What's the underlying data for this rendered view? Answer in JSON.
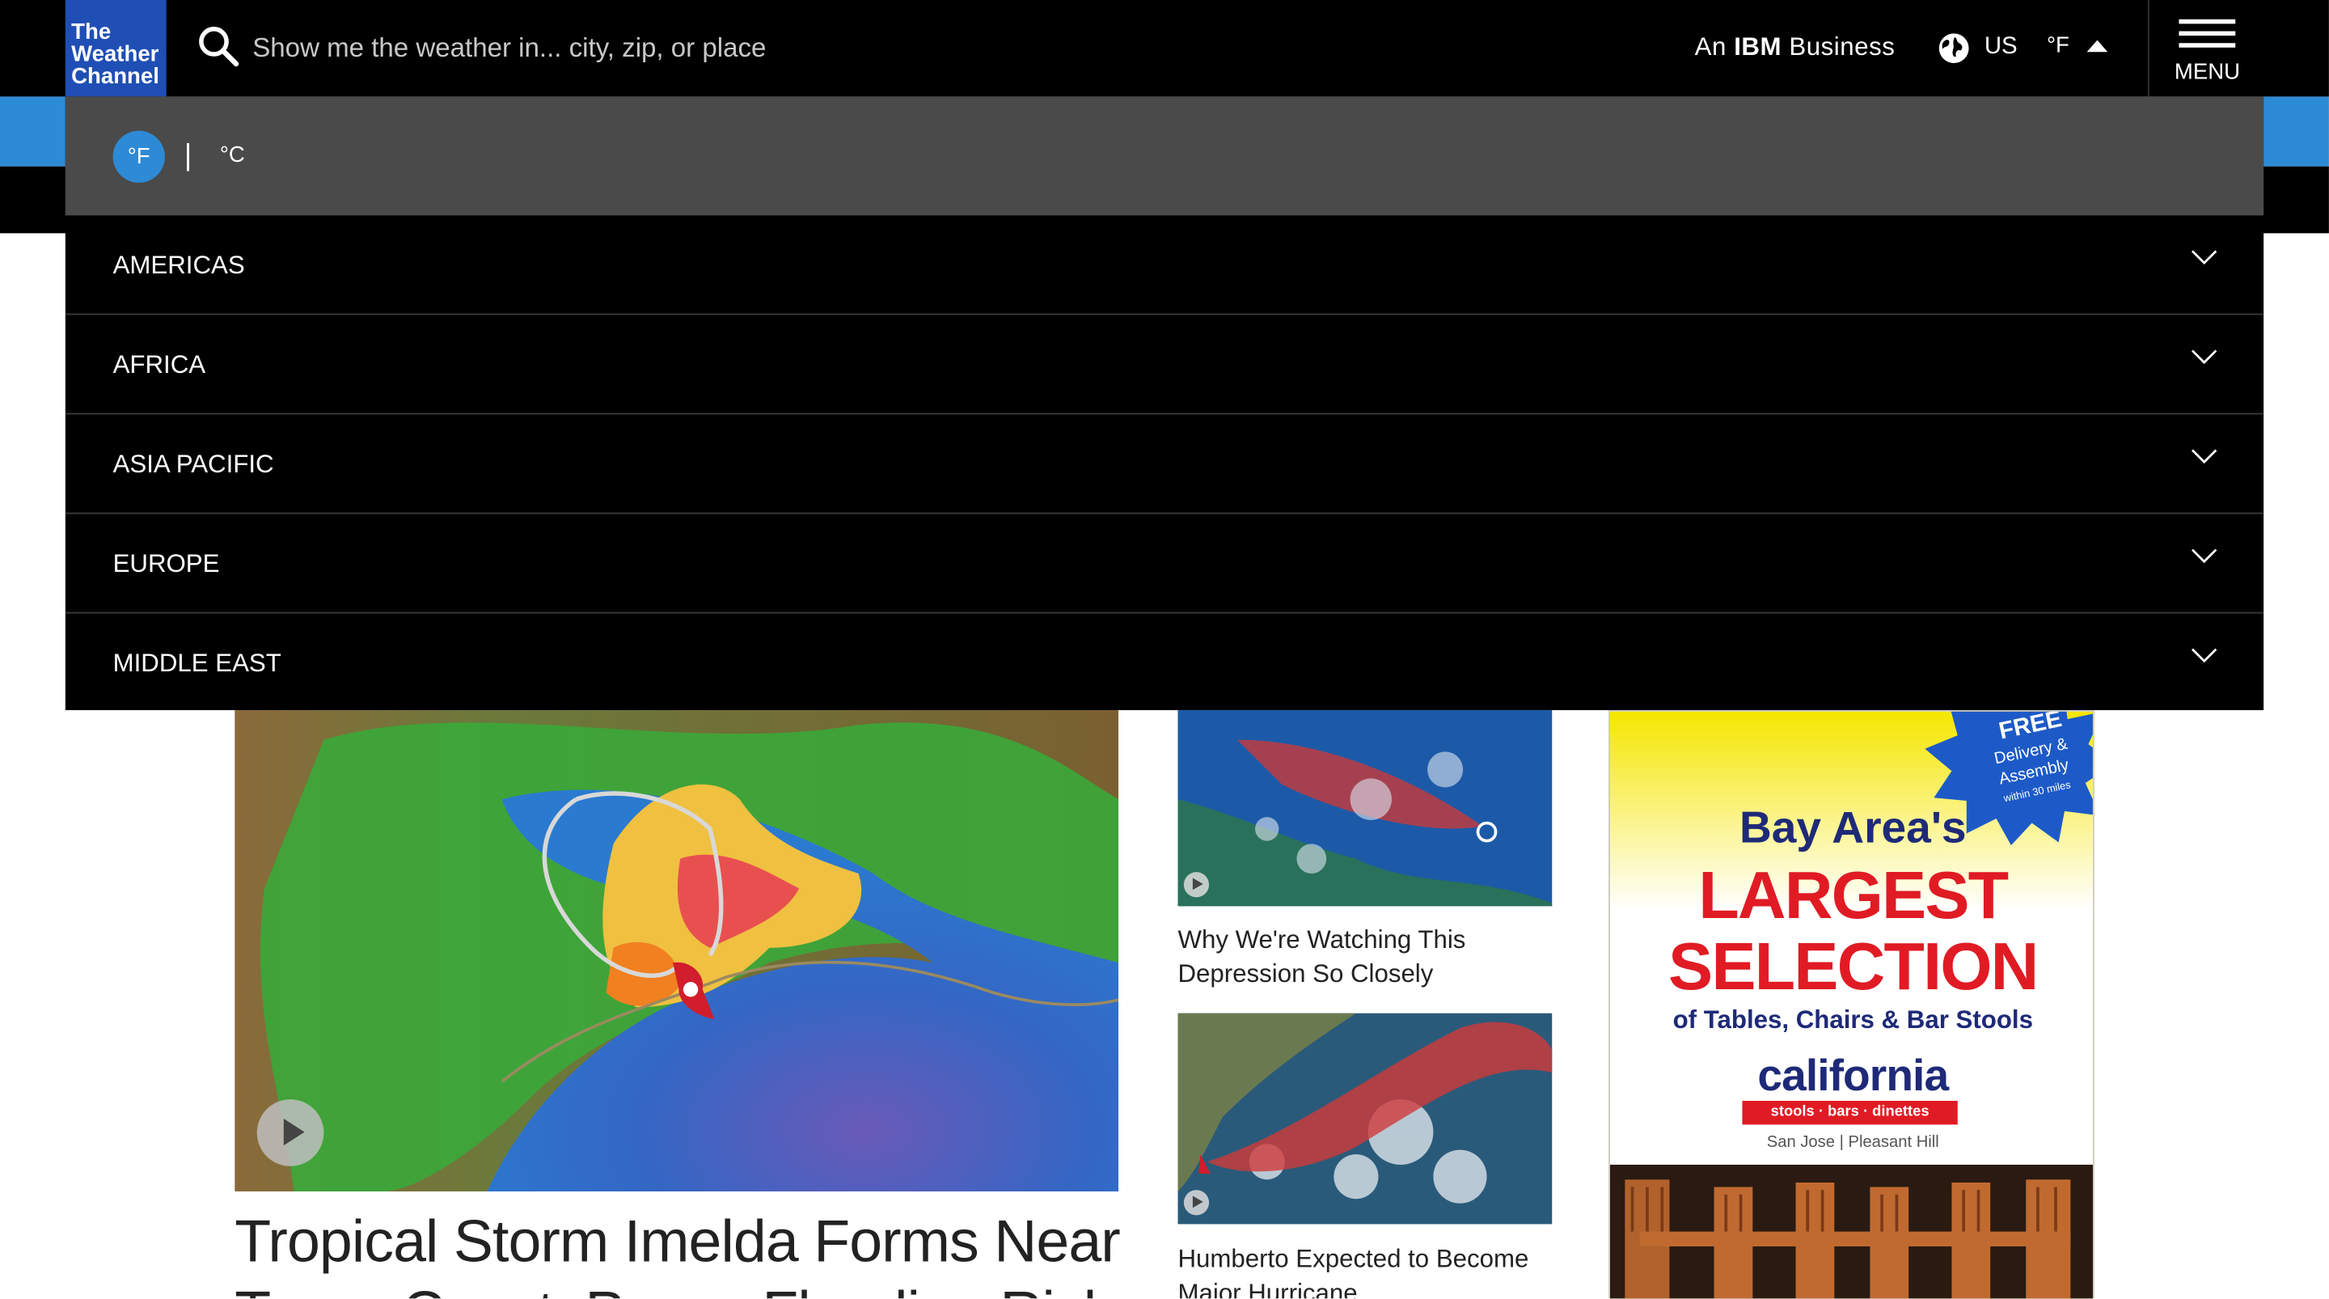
{
  "header": {
    "logo_lines": [
      "The",
      "Weather",
      "Channel"
    ],
    "search_placeholder": "Show me the weather in... city, zip, or place",
    "ibm_prefix": "An ",
    "ibm_brand": "IBM",
    "ibm_suffix": " Business",
    "region_label": "US",
    "unit_label": "°F",
    "menu_label": "MENU"
  },
  "units_panel": {
    "fahrenheit": "°F",
    "separator": "|",
    "celsius": "°C",
    "selected": "°F"
  },
  "regions": [
    "AMERICAS",
    "AFRICA",
    "ASIA PACIFIC",
    "EUROPE",
    "MIDDLE EAST"
  ],
  "content": {
    "main_headline": "Tropical Storm Imelda Forms Near Texas Coast; Poses Flooding Risk",
    "stories": [
      {
        "title": "Why We're Watching This Depression So Closely"
      },
      {
        "title": "Humberto Expected to Become Major Hurricane"
      }
    ]
  },
  "ad": {
    "burst_lines": [
      "FREE",
      "Delivery &",
      "Assembly",
      "within 30 miles"
    ],
    "line1": "Bay Area's",
    "line2": "LARGEST",
    "line3": "SELECTION",
    "line4": "of Tables, Chairs & Bar Stools",
    "brand": "california",
    "tagline": "stools · bars · dinettes",
    "locations": "San Jose  |  Pleasant Hill"
  },
  "colors": {
    "accent_blue": "#2d8ad6",
    "logo_blue": "#1f4fb4",
    "header_bg": "#000000",
    "units_bg": "#4a4a4a",
    "ad_red": "#e01b24",
    "ad_navy": "#1e2a78"
  }
}
